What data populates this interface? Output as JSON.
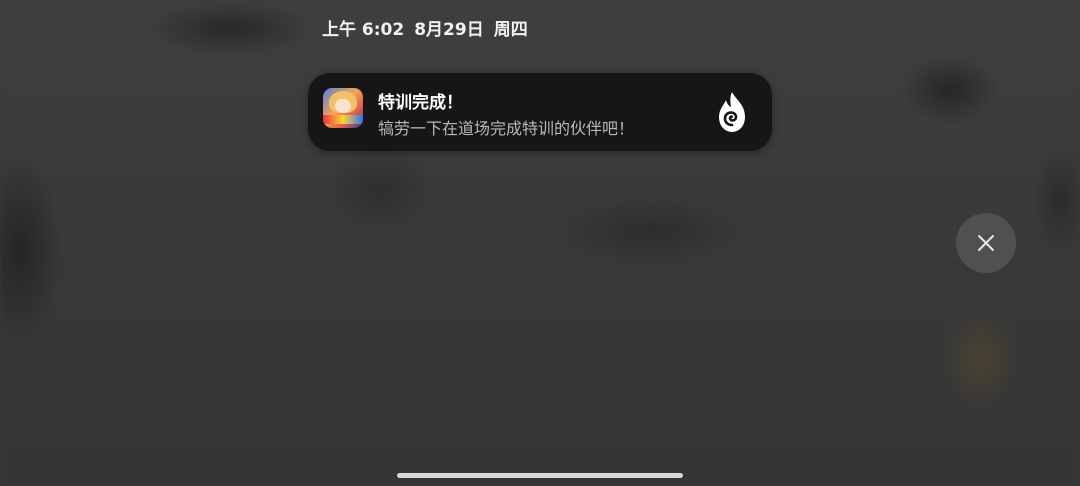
{
  "status_bar": {
    "time": "上午 6:02",
    "date": "8月29日",
    "weekday": "周四"
  },
  "notification": {
    "app_icon": "game-app-icon",
    "title": "特训完成！",
    "body": "犒劳一下在道场完成特训的伙伴吧！",
    "action_icon": "flame-spiral-icon",
    "background_color": "#161616"
  },
  "dismiss_button": {
    "icon": "close-icon"
  },
  "home_indicator": {
    "icon": "home-bar"
  }
}
